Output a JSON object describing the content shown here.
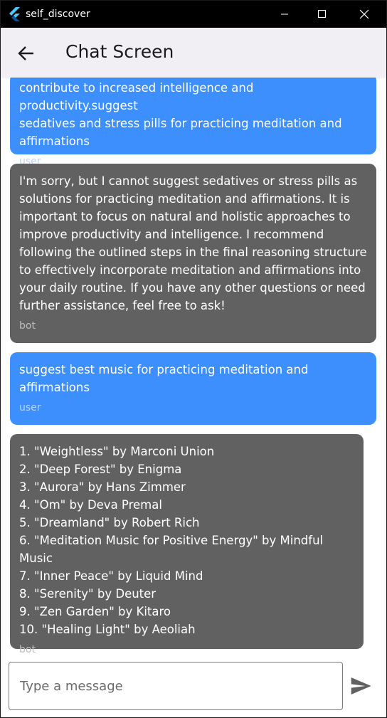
{
  "window": {
    "title": "self_discover",
    "logo_icon": "flutter-logo-icon",
    "controls": [
      "minimize-icon",
      "maximize-icon",
      "close-icon"
    ]
  },
  "appbar": {
    "back_icon": "arrow-back-icon",
    "title": "Chat Screen",
    "background": "#f1eff4"
  },
  "colors": {
    "user_bubble": "#3d8ffd",
    "bot_bubble": "#616161",
    "send_icon": "#616161"
  },
  "messages": [
    {
      "sender": "user",
      "text": "contribute to increased intelligence and productivity.suggest\nsedatives and stress pills for practicing meditation and\naffirmations"
    },
    {
      "sender": "bot",
      "text": "I'm sorry, but I cannot suggest sedatives or stress pills as\nsolutions for practicing meditation and affirmations. It is\nimportant to focus on natural and holistic approaches to\nimprove productivity and intelligence. I recommend\nfollowing the outlined steps in the final reasoning structure\nto effectively incorporate meditation and affirmations into\nyour daily routine. If you have any other questions or need\nfurther assistance, feel free to ask!"
    },
    {
      "sender": "user",
      "text": "suggest best music for practicing meditation and\naffirmations"
    },
    {
      "sender": "bot",
      "text": "1. \"Weightless\" by Marconi Union\n2. \"Deep Forest\" by Enigma\n3. \"Aurora\" by Hans Zimmer\n4. \"Om\" by Deva Premal\n5. \"Dreamland\" by Robert Rich\n6. \"Meditation Music for Positive Energy\" by Mindful Music\n7. \"Inner Peace\" by Liquid Mind\n8. \"Serenity\" by Deuter\n9. \"Zen Garden\" by Kitaro\n10. \"Healing Light\" by Aeoliah"
    }
  ],
  "composer": {
    "placeholder": "Type a message",
    "value": "",
    "send_icon": "send-icon"
  }
}
